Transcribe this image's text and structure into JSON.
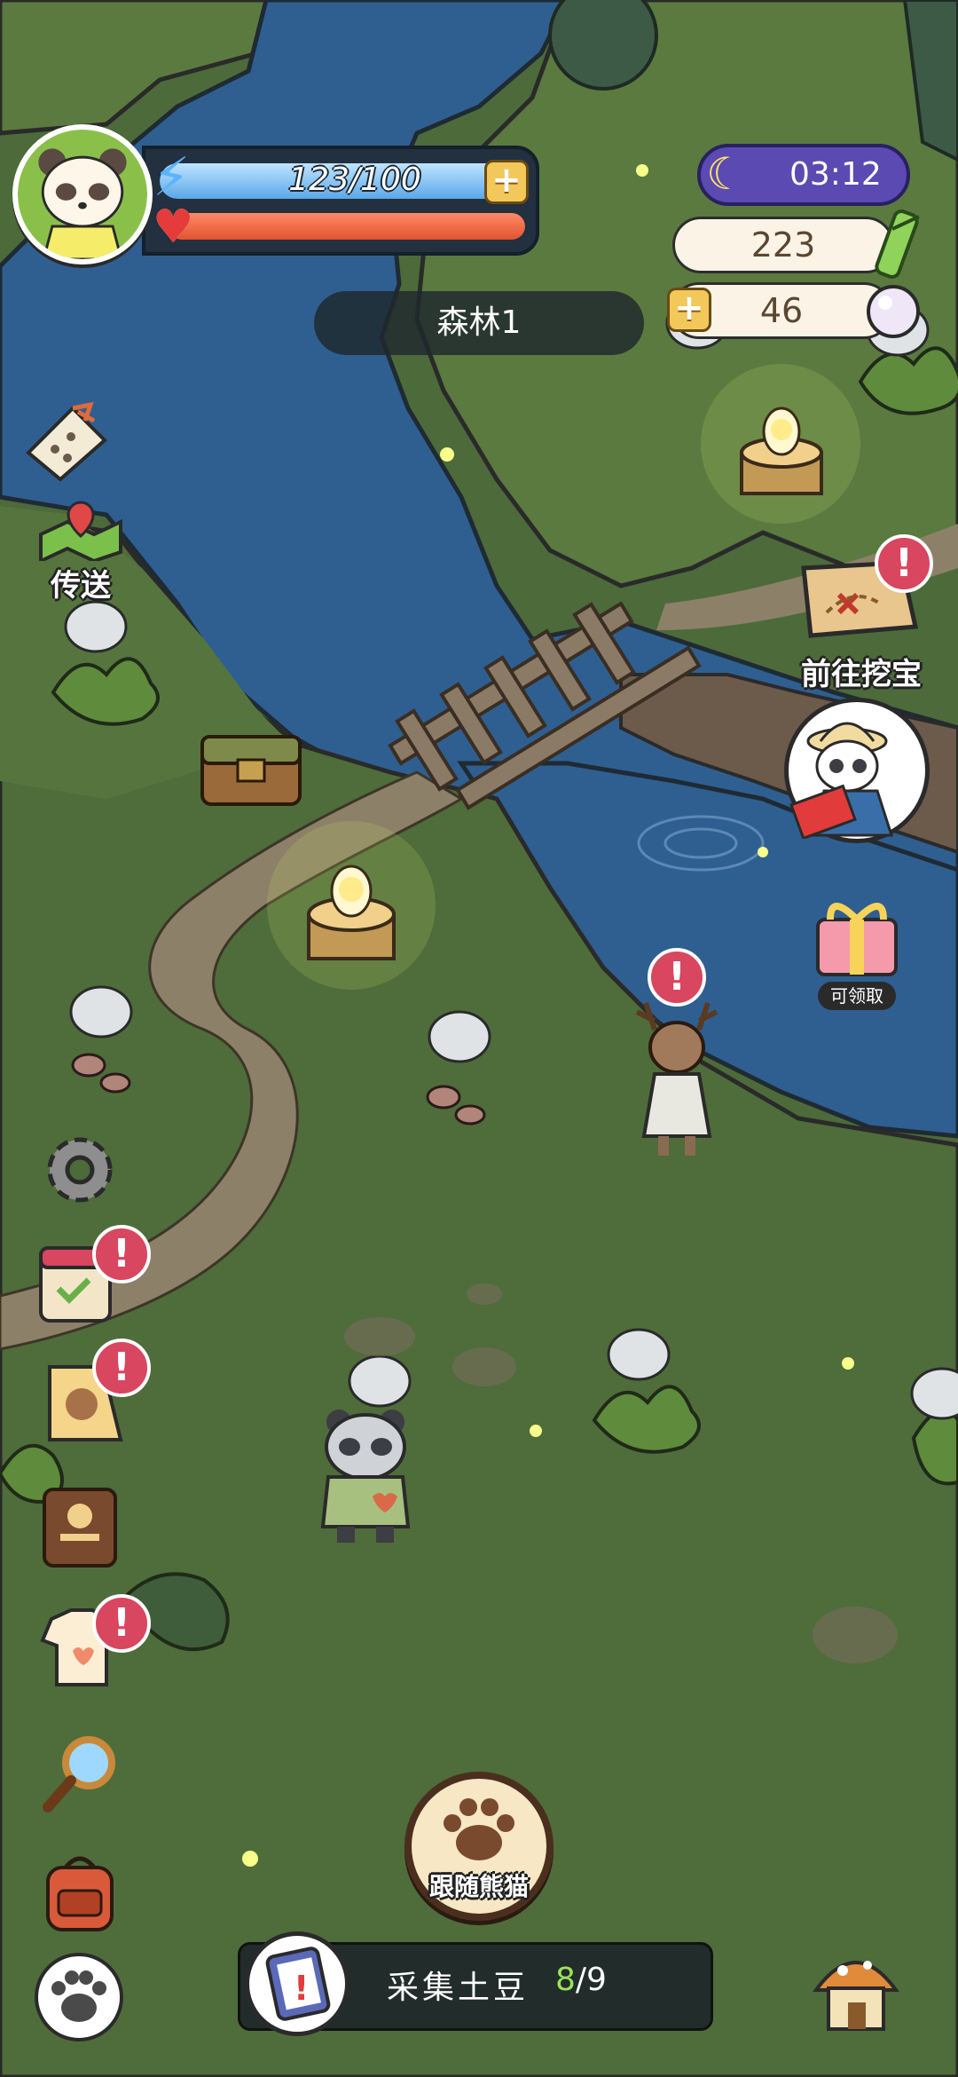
{
  "player": {
    "energy_text": "123/100",
    "energy_fraction": 1.0,
    "health_fraction": 1.0
  },
  "location": {
    "name": "森林1"
  },
  "clock": {
    "time": "03:12"
  },
  "resources": {
    "bamboo": "223",
    "pearls": "46"
  },
  "side_left": {
    "teleport_label": "传送"
  },
  "side_right": {
    "dig_treasure_label": "前往挖宝",
    "gift_label": "可领取"
  },
  "badges": {
    "alert": "!"
  },
  "bottom": {
    "follow_label": "跟随熊猫",
    "quest_text": "采集土豆",
    "quest_current": "8",
    "quest_total": "/9"
  },
  "colors": {
    "river": "#2f5f91",
    "grass": "#4d6a3a",
    "path": "#8d8068",
    "energy": "#5aa8e8",
    "health": "#e2532f",
    "badge": "#d8465f",
    "time_pill": "#5a4ab2"
  },
  "icons": {
    "plus": "+",
    "moon": "☾",
    "heart": "♥",
    "bolt": "⚡"
  }
}
